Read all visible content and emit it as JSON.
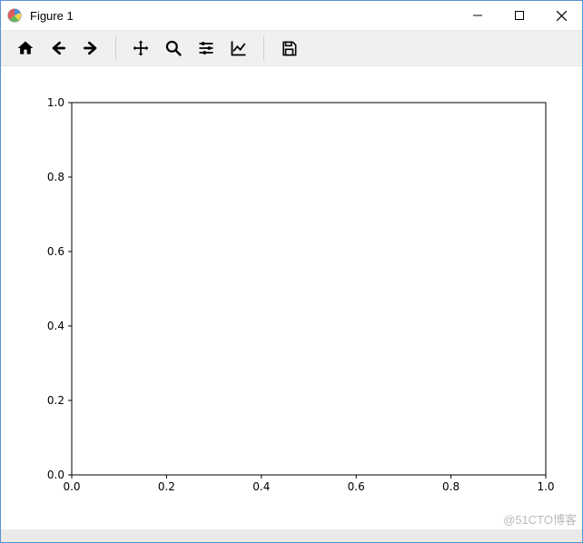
{
  "window": {
    "title": "Figure 1"
  },
  "toolbar": {
    "home": "Home",
    "back": "Back",
    "forward": "Forward",
    "pan": "Pan",
    "zoom": "Zoom",
    "subplots": "Configure subplots",
    "axes": "Edit axis",
    "save": "Save"
  },
  "watermark": "@51CTO博客",
  "chart_data": {
    "type": "line",
    "title": "",
    "xlabel": "",
    "ylabel": "",
    "series": [],
    "xlim": [
      0.0,
      1.0
    ],
    "ylim": [
      0.0,
      1.0
    ],
    "xticks": [
      0.0,
      0.2,
      0.4,
      0.6,
      0.8,
      1.0
    ],
    "yticks": [
      0.0,
      0.2,
      0.4,
      0.6,
      0.8,
      1.0
    ],
    "xtick_labels": [
      "0.0",
      "0.2",
      "0.4",
      "0.6",
      "0.8",
      "1.0"
    ],
    "ytick_labels": [
      "0.0",
      "0.2",
      "0.4",
      "0.6",
      "0.8",
      "1.0"
    ],
    "grid": false
  }
}
